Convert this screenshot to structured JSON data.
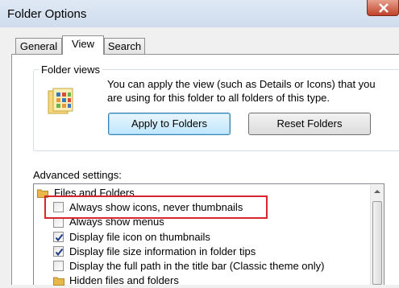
{
  "window": {
    "title": "Folder Options"
  },
  "tabs": [
    {
      "label": "General"
    },
    {
      "label": "View"
    },
    {
      "label": "Search"
    }
  ],
  "folder_views": {
    "label": "Folder views",
    "description": "You can apply the view (such as Details or Icons) that you are using for this folder to all folders of this type.",
    "apply_button": "Apply to Folders",
    "reset_button": "Reset Folders"
  },
  "advanced": {
    "label": "Advanced settings:",
    "items": [
      {
        "label": "Files and Folders",
        "type": "folder"
      },
      {
        "label": "Always show icons, never thumbnails",
        "type": "checkbox",
        "checked": false
      },
      {
        "label": "Always show menus",
        "type": "checkbox",
        "checked": false
      },
      {
        "label": "Display file icon on thumbnails",
        "type": "checkbox",
        "checked": true
      },
      {
        "label": "Display file size information in folder tips",
        "type": "checkbox",
        "checked": true
      },
      {
        "label": "Display the full path in the title bar (Classic theme only)",
        "type": "checkbox",
        "checked": false
      },
      {
        "label": "Hidden files and folders",
        "type": "folder"
      }
    ]
  },
  "colors": {
    "highlight": "#d9252d",
    "accent": "#3c7fb1"
  }
}
